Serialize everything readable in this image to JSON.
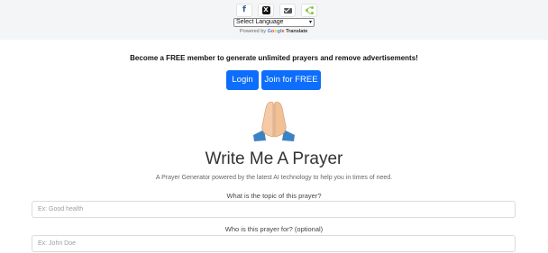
{
  "share": {
    "facebook_icon": "facebook-icon",
    "x_icon": "x-icon",
    "email_icon": "mail-icon",
    "share_icon": "share-icon"
  },
  "translate": {
    "select_value": "Select Language",
    "powered_by": "Powered by",
    "google_letters": [
      "G",
      "o",
      "o",
      "g",
      "l",
      "e"
    ],
    "translate_label": "Translate"
  },
  "promo": {
    "text": "Become a FREE member to generate unlimited prayers and remove advertisements!"
  },
  "buttons": {
    "login": "Login",
    "join": "Join for FREE"
  },
  "hero": {
    "icon": "praying-hands-icon",
    "title": "Write Me A Prayer",
    "subtitle": "A Prayer Generator powered by the latest AI technology to help you in times of need."
  },
  "form": {
    "topic_label": "What is the topic of this prayer?",
    "topic_placeholder": "Ex: Good health",
    "for_label": "Who is this prayer for? (optional)",
    "for_placeholder": "Ex: John Doe"
  },
  "colors": {
    "primary": "#0d6efd",
    "topbar_bg": "#f4f5f7"
  }
}
